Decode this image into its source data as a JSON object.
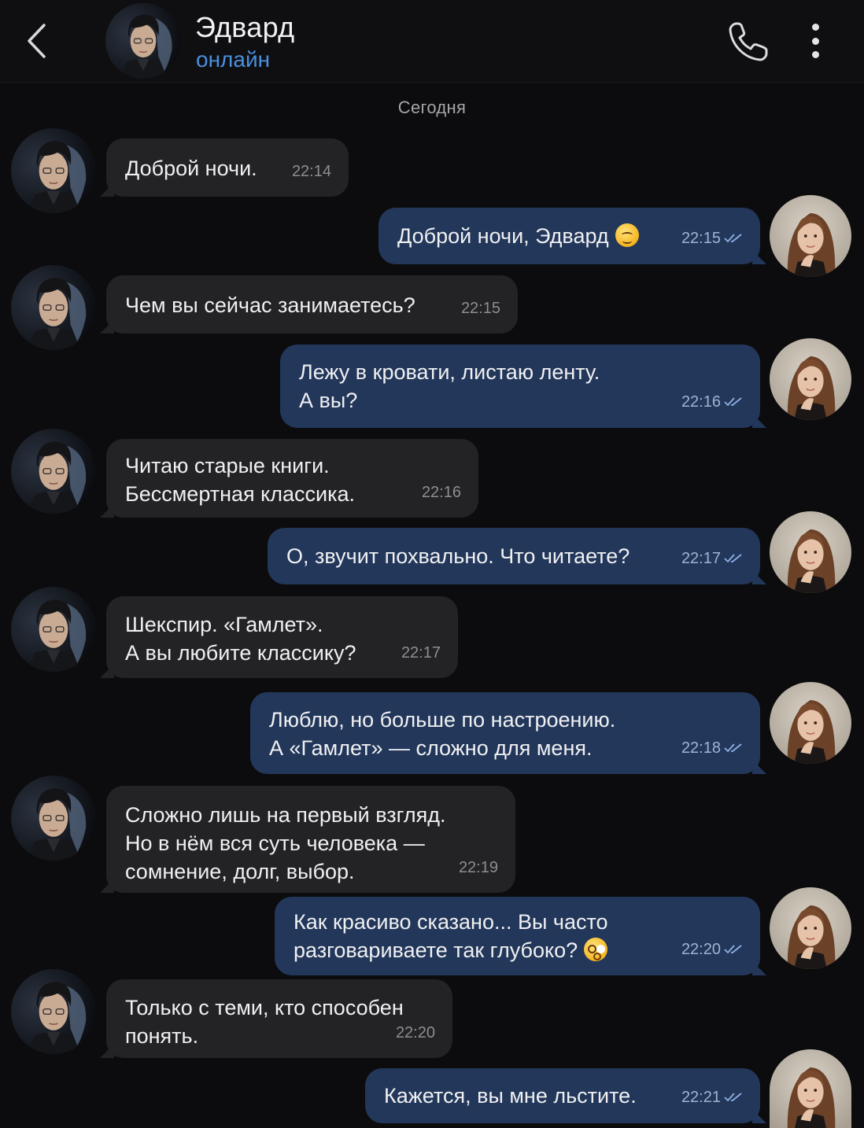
{
  "header": {
    "back_icon": "chevron-left-icon",
    "contact_name": "Эдвард",
    "status": "онлайн",
    "call_icon": "phone-icon",
    "menu_icon": "more-vertical-icon"
  },
  "date_separator": "Сегодня",
  "colors": {
    "incoming_bubble": "#232326",
    "outgoing_bubble": "#22375a",
    "accent": "#4a8fe0",
    "background": "#0c0c0e"
  },
  "messages": [
    {
      "direction": "in",
      "text": "Доброй ночи.",
      "time": "22:14"
    },
    {
      "direction": "out",
      "text": "Доброй ночи, Эдвард",
      "emoji": "smiling-face",
      "time": "22:15",
      "read": true
    },
    {
      "direction": "in",
      "text": "Чем вы сейчас занимаетесь?",
      "time": "22:15"
    },
    {
      "direction": "out",
      "text": "Лежу в кровати, листаю ленту.\nА вы?",
      "time": "22:16",
      "read": true
    },
    {
      "direction": "in",
      "text": "Читаю старые книги.\nБессмертная классика.",
      "time": "22:16"
    },
    {
      "direction": "out",
      "text": "О, звучит похвально. Что читаете?",
      "time": "22:17",
      "read": true
    },
    {
      "direction": "in",
      "text": "Шекспир. «Гамлет».\nА вы любите классику?",
      "time": "22:17"
    },
    {
      "direction": "out",
      "text": "Люблю, но больше по настроению.\nА «Гамлет» — сложно для меня.",
      "time": "22:18",
      "read": true
    },
    {
      "direction": "in",
      "text": "Сложно лишь на первый взгляд.\nНо в нём вся суть человека —\nсомнение, долг, выбор.",
      "time": "22:19"
    },
    {
      "direction": "out",
      "text": "Как красиво сказано... Вы часто\nразговариваете так глубоко?",
      "emoji": "flushed-face",
      "time": "22:20",
      "read": true
    },
    {
      "direction": "in",
      "text": "Только с теми, кто способен\nпонять.",
      "time": "22:20"
    },
    {
      "direction": "out",
      "text": "Кажется, вы мне льстите.",
      "time": "22:21",
      "read": true
    }
  ]
}
